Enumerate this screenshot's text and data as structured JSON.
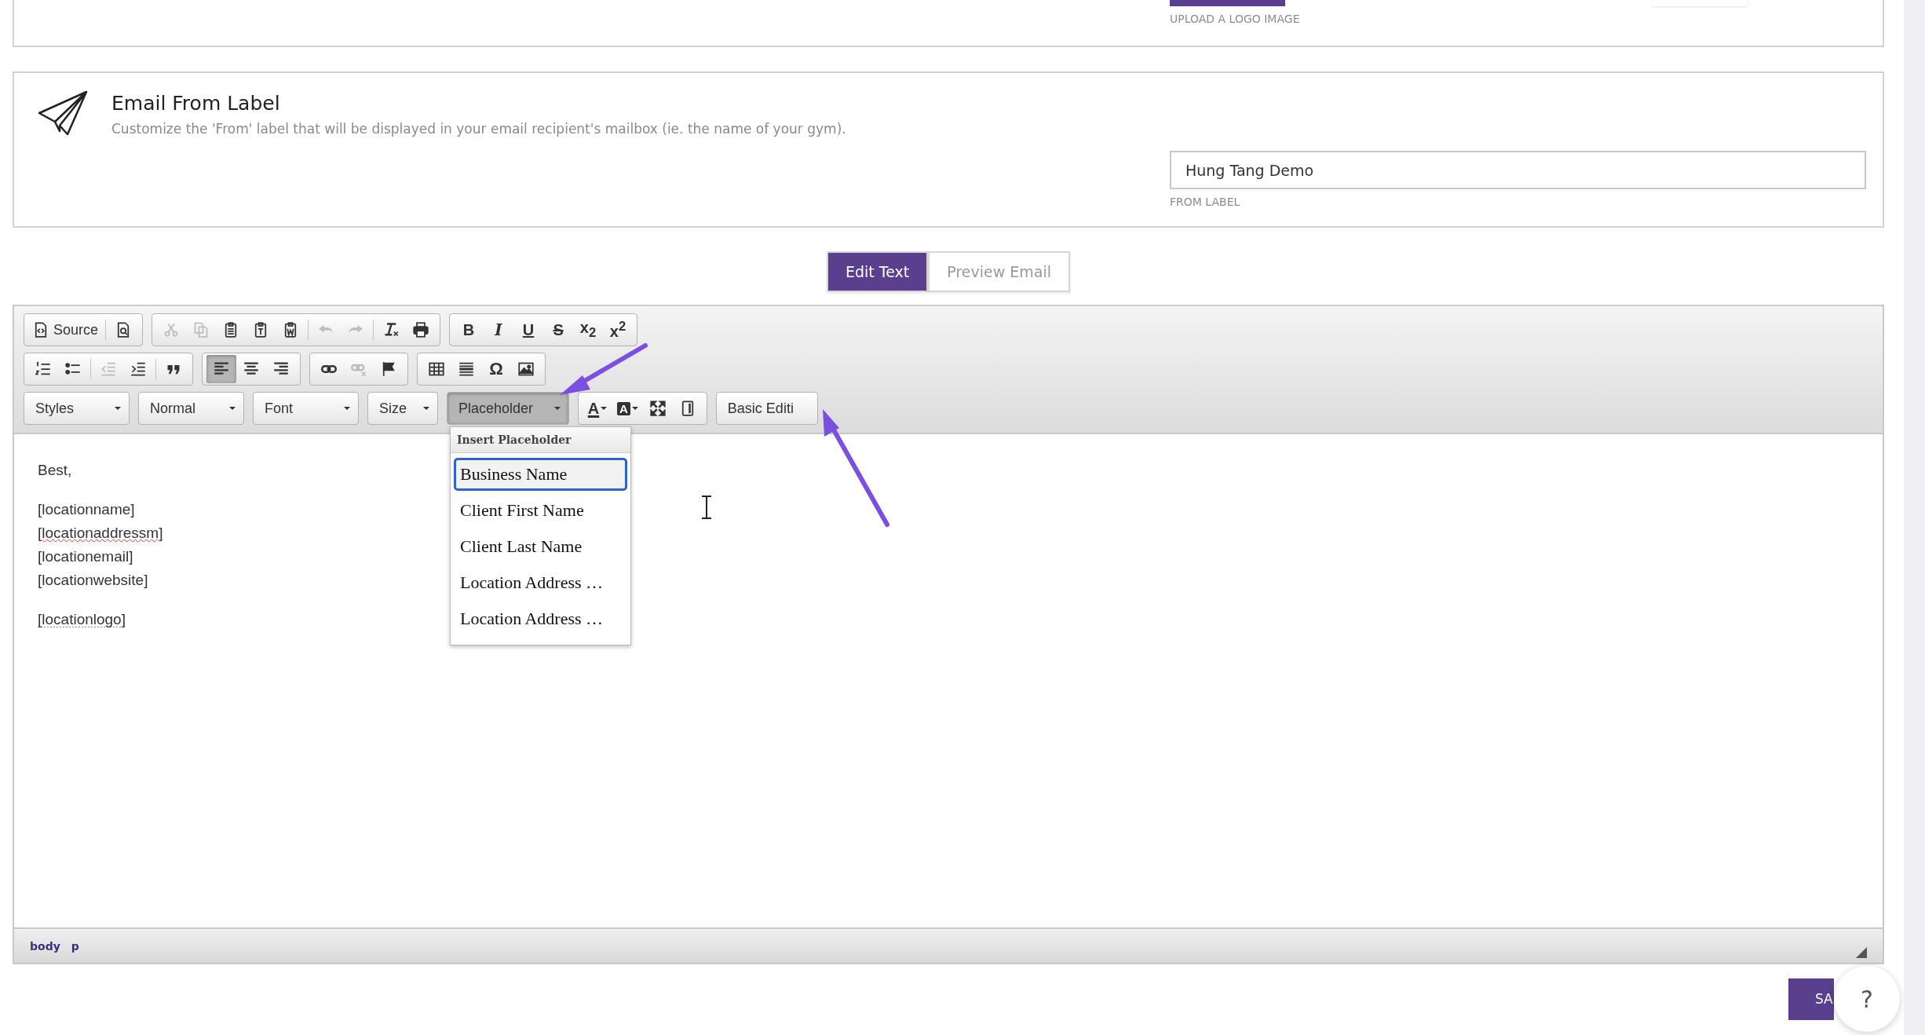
{
  "logo_card": {
    "upload_label": "UPLOAD A LOGO IMAGE"
  },
  "from_label_card": {
    "title": "Email From Label",
    "description": "Customize the 'From' label that will be displayed in your email recipient's mailbox (ie. the name of your gym).",
    "value": "Hung Tang Demo",
    "field_label": "FROM LABEL"
  },
  "tabs": [
    {
      "label": "Edit Text",
      "selected": true
    },
    {
      "label": "Preview Email",
      "selected": false
    }
  ],
  "toolbar": {
    "top_row": [
      {
        "items": [
          {
            "kind": "source",
            "label": "Source",
            "disabled": false
          },
          {
            "kind": "separator"
          },
          {
            "kind": "preview",
            "disabled": false
          }
        ]
      },
      {
        "items": [
          {
            "kind": "cut",
            "disabled": true
          },
          {
            "kind": "copy",
            "disabled": true
          },
          {
            "kind": "paste",
            "disabled": false
          },
          {
            "kind": "paste-text",
            "disabled": false
          },
          {
            "kind": "paste-word",
            "disabled": false
          },
          {
            "kind": "separator"
          },
          {
            "kind": "undo",
            "disabled": true
          },
          {
            "kind": "redo",
            "disabled": true
          },
          {
            "kind": "separator"
          },
          {
            "kind": "remove-format",
            "disabled": false
          },
          {
            "kind": "print",
            "disabled": false
          }
        ]
      },
      {
        "items": [
          {
            "kind": "bold",
            "label": "B",
            "disabled": false
          },
          {
            "kind": "italic",
            "label": "I",
            "disabled": false
          },
          {
            "kind": "underline",
            "label": "U",
            "disabled": false
          },
          {
            "kind": "strike",
            "label": "S",
            "disabled": false
          },
          {
            "kind": "subscript",
            "label": "x$_{2}$",
            "disabled": false
          },
          {
            "kind": "superscript",
            "label": "x$^{2}$",
            "disabled": false
          }
        ]
      }
    ],
    "middle_row": [
      {
        "items": [
          {
            "kind": "numbered-list",
            "disabled": false
          },
          {
            "kind": "bulleted-list",
            "disabled": false
          },
          {
            "kind": "separator"
          },
          {
            "kind": "outdent",
            "disabled": true
          },
          {
            "kind": "indent",
            "disabled": false
          },
          {
            "kind": "separator"
          },
          {
            "kind": "blockquote",
            "disabled": false
          }
        ]
      },
      {
        "items": [
          {
            "kind": "align-left",
            "disabled": false,
            "selected": true
          },
          {
            "kind": "align-center",
            "disabled": false,
            "selected": false
          },
          {
            "kind": "align-right",
            "disabled": false,
            "selected": false
          }
        ]
      },
      {
        "items": [
          {
            "kind": "link",
            "disabled": false
          },
          {
            "kind": "unlink",
            "disabled": true
          },
          {
            "kind": "anchor",
            "disabled": false
          }
        ]
      },
      {
        "items": [
          {
            "kind": "table",
            "disabled": false
          },
          {
            "kind": "horizontal-rule",
            "disabled": false
          },
          {
            "kind": "special-char",
            "label": "Ω",
            "disabled": false
          },
          {
            "kind": "image",
            "disabled": false
          }
        ]
      }
    ],
    "bottom_row": [
      {
        "kind": "combo",
        "label": "Styles",
        "pressed": false
      },
      {
        "kind": "combo",
        "label": "Normal",
        "pressed": false
      },
      {
        "kind": "combo",
        "label": "Font",
        "pressed": false
      },
      {
        "kind": "combo",
        "label": "Size",
        "pressed": false
      },
      {
        "kind": "combo",
        "label": "Placeholder",
        "pressed": true
      },
      {
        "items": [
          {
            "kind": "text-color",
            "label": "A",
            "disabled": false
          },
          {
            "kind": "bg-color",
            "label": "A",
            "disabled": false
          },
          {
            "kind": "maximize",
            "disabled": false
          },
          {
            "kind": "show-blocks",
            "disabled": false
          }
        ]
      },
      {
        "kind": "text-button",
        "label": "Basic Editi"
      }
    ]
  },
  "placeholder_menu": {
    "title": "Insert Placeholder",
    "items": [
      {
        "label": "Business Name",
        "selected": true
      },
      {
        "label": "Client First Name",
        "selected": false
      },
      {
        "label": "Client Last Name",
        "selected": false
      },
      {
        "label": "Location Address …",
        "selected": false
      },
      {
        "label": "Location Address …",
        "selected": false
      }
    ]
  },
  "content": {
    "paragraphs": [
      [
        {
          "text": "Best,",
          "misspelled": false,
          "dotted_underline": false
        }
      ],
      [
        {
          "text": "[locationname]",
          "misspelled": false,
          "dotted_underline": false
        },
        {
          "text": "[locationaddressm]",
          "misspelled": true,
          "dotted_underline": false
        },
        {
          "text": "[locationemail]",
          "misspelled": false,
          "dotted_underline": false
        },
        {
          "text": "[locationwebsite]",
          "misspelled": false,
          "dotted_underline": false
        }
      ],
      [
        {
          "text": "[locationlogo]",
          "misspelled": false,
          "dotted_underline": true
        }
      ]
    ]
  },
  "status_path": [
    "body",
    "p"
  ],
  "save_button": "SA",
  "help_button": "?"
}
